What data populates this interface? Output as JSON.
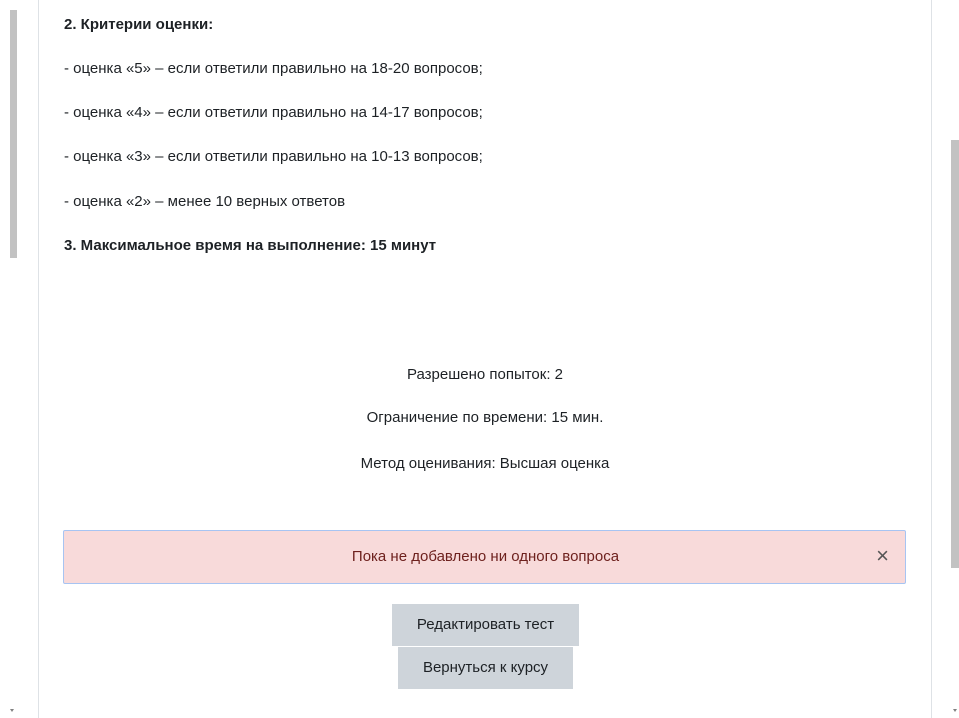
{
  "intro": {
    "heading_criteria": "2. Критерии оценки:",
    "criteria": [
      "-  оценка «5» – если ответили правильно на 18-20 вопросов;",
      "-  оценка «4» – если ответили правильно на 14-17 вопросов;",
      "-  оценка «3» – если ответили правильно на 10-13 вопросов;",
      " -  оценка «2» – менее 10 верных ответов"
    ],
    "heading_time": "3. Максимальное время на выполнение: 15 минут"
  },
  "quiz_info": {
    "attempts": "Разрешено попыток: 2",
    "time_limit": "Ограничение по времени: 15 мин.",
    "grading_method": "Метод оценивания: Высшая оценка"
  },
  "alert": {
    "message": "Пока не добавлено ни одного вопроса",
    "close_symbol": "×"
  },
  "buttons": {
    "edit_quiz": "Редактировать тест",
    "back_to_course": "Вернуться к курсу"
  }
}
